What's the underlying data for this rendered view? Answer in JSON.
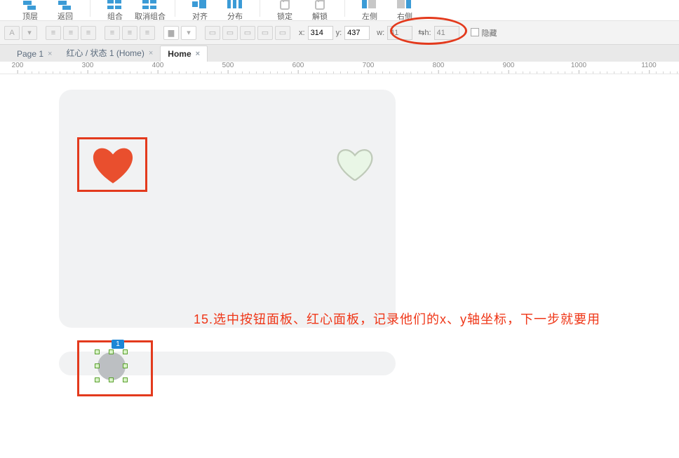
{
  "ribbon": {
    "buttons": [
      "顶层",
      "返回",
      "组合",
      "取消组合",
      "对齐",
      "分布",
      "锁定",
      "解锁",
      "左侧",
      "右侧"
    ]
  },
  "coords": {
    "x_label": "x:",
    "x": "314",
    "y_label": "y:",
    "y": "437",
    "w_label": "w:",
    "w": "41",
    "h_label": "h:",
    "h": "41",
    "hide": "隐藏"
  },
  "tabs": {
    "page1": "Page 1",
    "dyn": "红心 / 状态 1 (Home)",
    "home": "Home"
  },
  "ruler_ticks": [
    "200",
    "300",
    "400",
    "500",
    "600",
    "700",
    "800",
    "900",
    "1000",
    "1100"
  ],
  "selection_badge": "1",
  "annotation": "15.选中按钮面板、红心面板，记录他们的x、y轴坐标，下一步就要用"
}
